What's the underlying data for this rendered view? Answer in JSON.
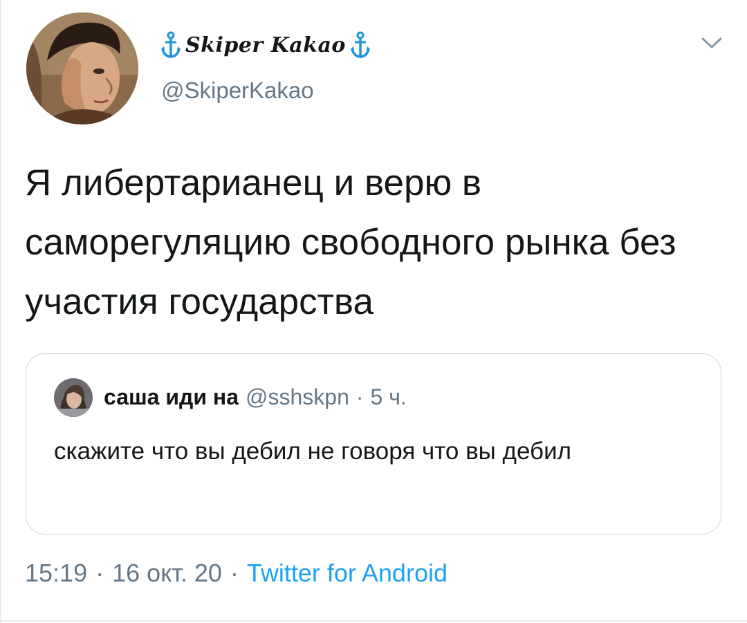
{
  "user": {
    "display_name": "Skiper Kakao",
    "handle": "@SkiperKakao",
    "name_icon": "anchor-icon"
  },
  "tweet": {
    "text": "Я либертарианец и верю в саморегуляцию свободного рынка без участия государства"
  },
  "quoted_tweet": {
    "name": "саша иди на",
    "handle": "@sshskpn",
    "separator": "·",
    "time": "5 ч.",
    "text": "скажите что вы дебил не говоря что вы дебил"
  },
  "meta": {
    "time": "15:19",
    "separator": "·",
    "date": "16 окт. 20",
    "source": "Twitter for Android"
  },
  "colors": {
    "link": "#1da1f2",
    "secondary_text": "#657786",
    "border": "#ccd6dd",
    "anchor": "#1b95e0"
  },
  "icons": {
    "menu": "chevron-down-icon",
    "avatar": "avatar",
    "quote_avatar": "avatar"
  }
}
